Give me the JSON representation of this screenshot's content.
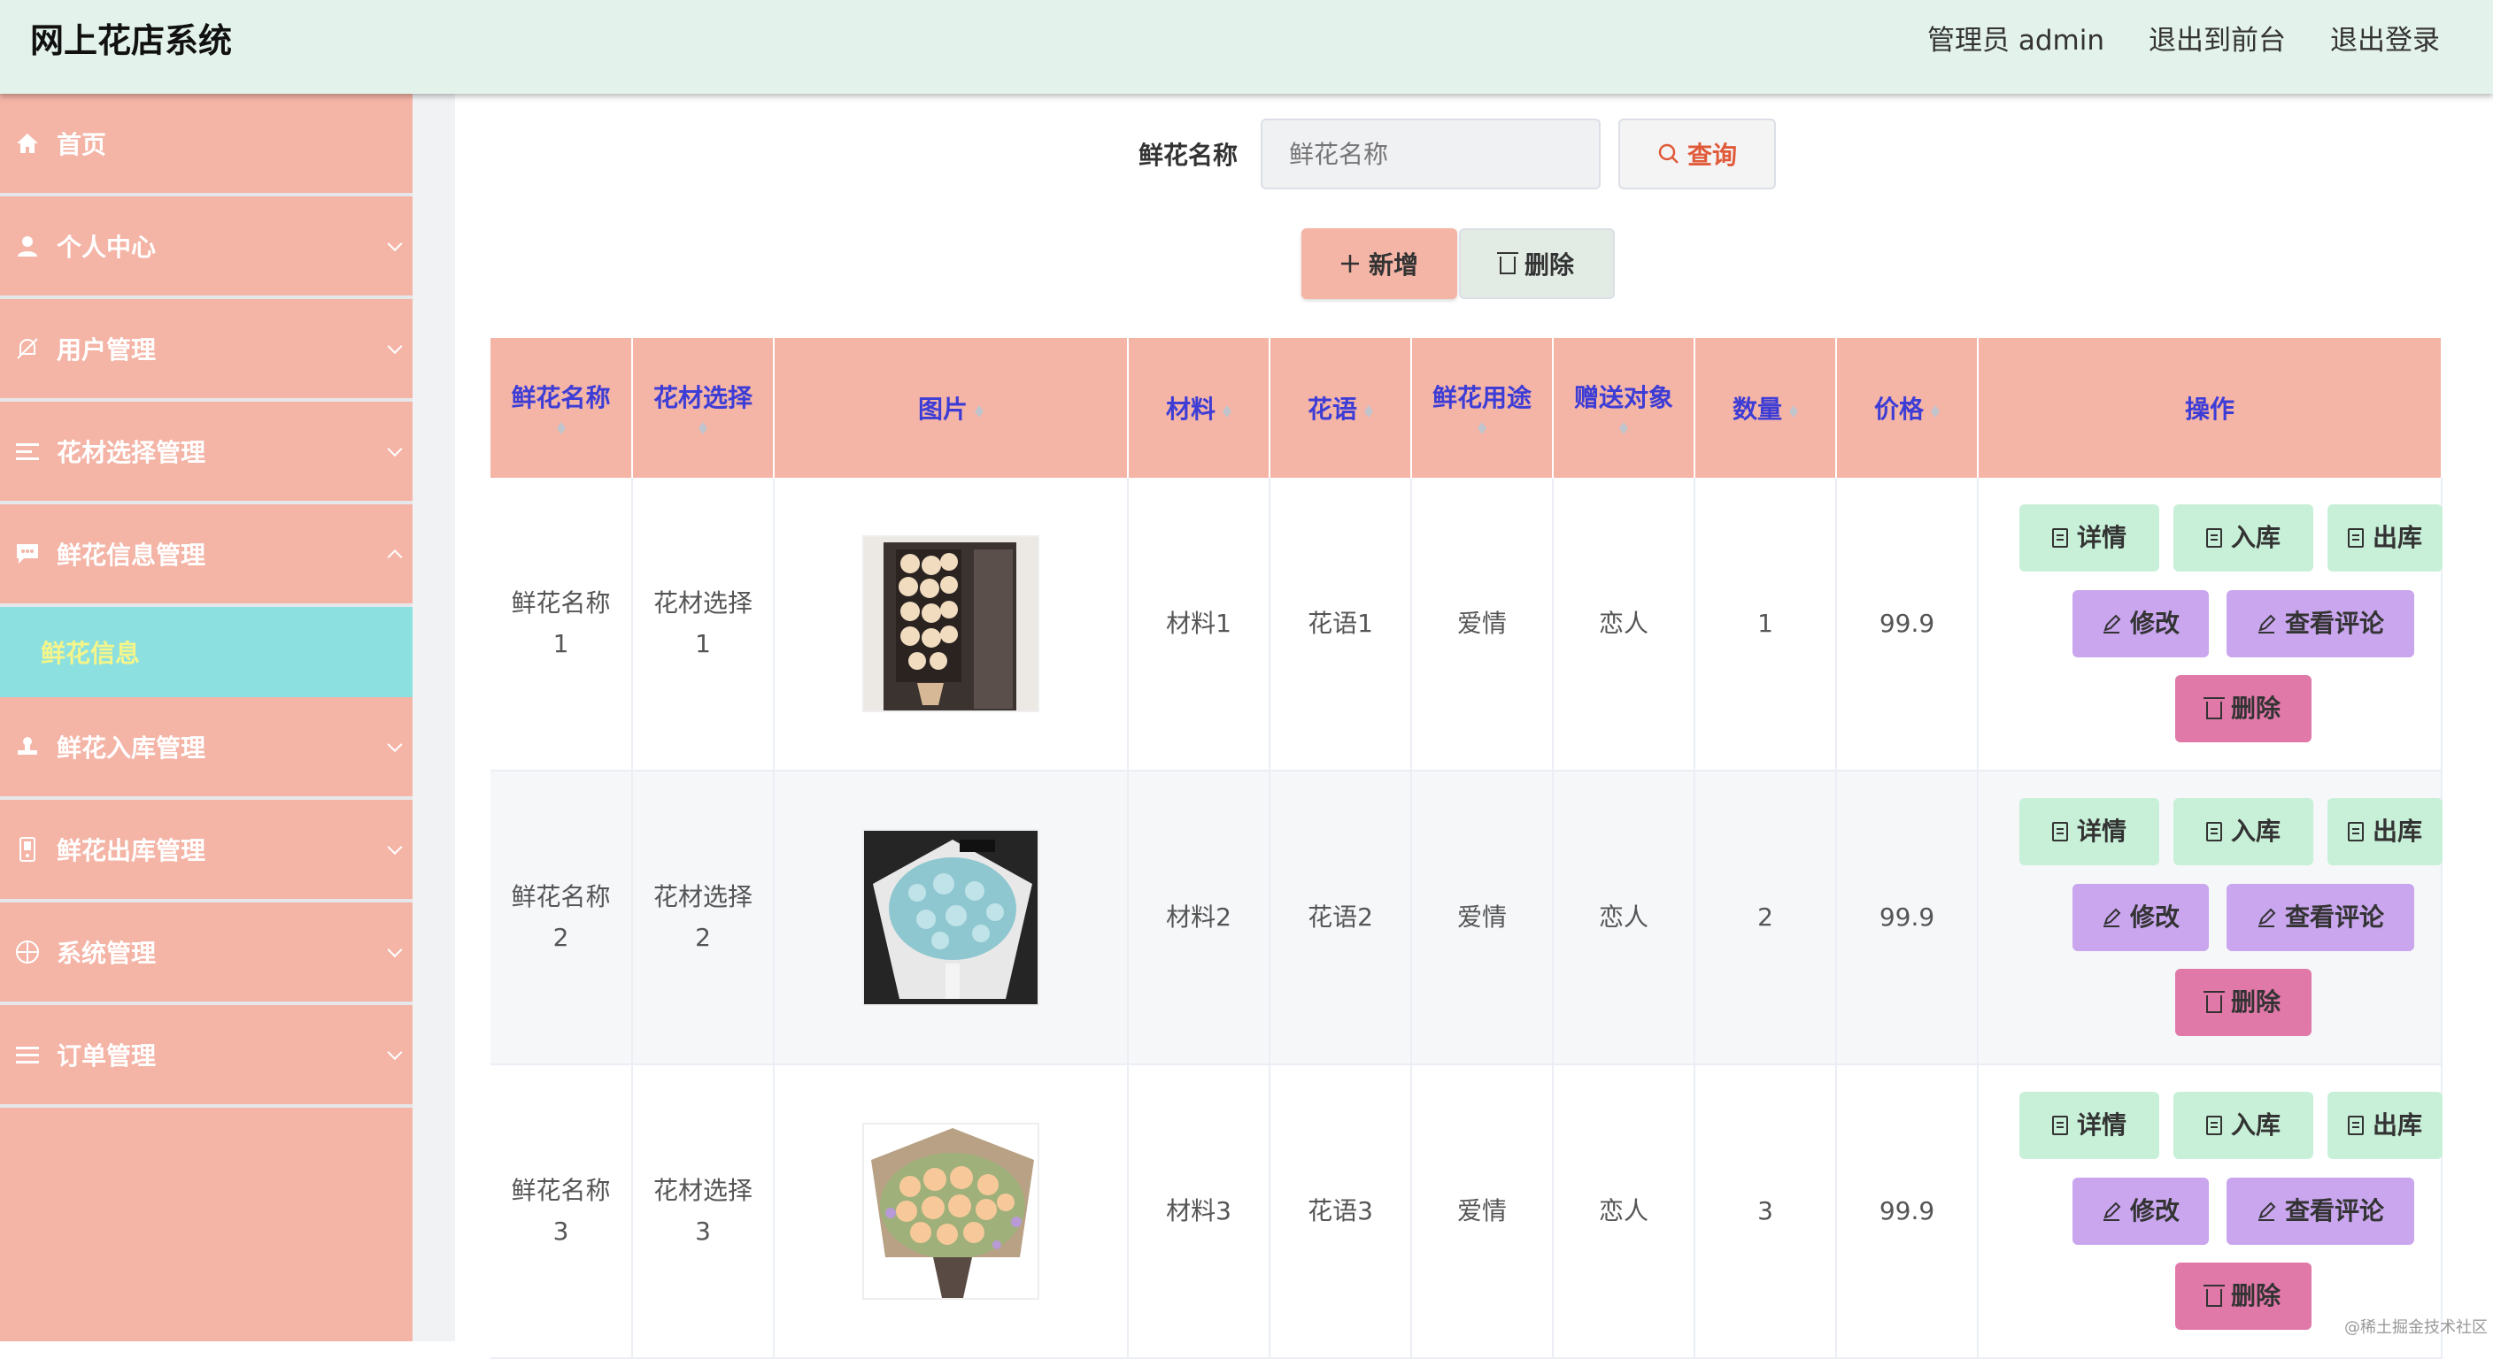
{
  "header": {
    "title": "网上花店系统",
    "admin_label": "管理员 admin",
    "to_front": "退出到前台",
    "logout": "退出登录"
  },
  "sidebar": {
    "items": [
      {
        "label": "首页",
        "icon": "home-icon"
      },
      {
        "label": "个人中心",
        "icon": "user-icon"
      },
      {
        "label": "用户管理",
        "icon": "bell-off-icon"
      },
      {
        "label": "花材选择管理",
        "icon": "list-icon"
      },
      {
        "label": "鲜花信息管理",
        "icon": "chat-icon"
      },
      {
        "label": "鲜花入库管理",
        "icon": "stamp-icon"
      },
      {
        "label": "鲜花出库管理",
        "icon": "phone-icon"
      },
      {
        "label": "系统管理",
        "icon": "globe-icon"
      },
      {
        "label": "订单管理",
        "icon": "menu-icon"
      }
    ],
    "active_sub": "鲜花信息"
  },
  "search": {
    "label": "鲜花名称",
    "placeholder": "鲜花名称",
    "query_label": "查询"
  },
  "toolbar": {
    "add_label": "新增",
    "delete_label": "删除"
  },
  "table": {
    "headers": [
      "鲜花名称",
      "花材选择",
      "图片",
      "材料",
      "花语",
      "鲜花用途",
      "赠送对象",
      "数量",
      "价格",
      "操作"
    ],
    "rows": [
      {
        "name": "鲜花名称",
        "name_no": "1",
        "material_choice": "花材选择",
        "material_no": "1",
        "material": "材料1",
        "language": "花语1",
        "use": "爱情",
        "target": "恋人",
        "qty": "1",
        "price": "99.9"
      },
      {
        "name": "鲜花名称",
        "name_no": "2",
        "material_choice": "花材选择",
        "material_no": "2",
        "material": "材料2",
        "language": "花语2",
        "use": "爱情",
        "target": "恋人",
        "qty": "2",
        "price": "99.9"
      },
      {
        "name": "鲜花名称",
        "name_no": "3",
        "material_choice": "花材选择",
        "material_no": "3",
        "material": "材料3",
        "language": "花语3",
        "use": "爱情",
        "target": "恋人",
        "qty": "3",
        "price": "99.9"
      }
    ],
    "ops": {
      "detail": "详情",
      "in": "入库",
      "out": "出库",
      "edit": "修改",
      "review": "查看评论",
      "delete": "删除"
    }
  },
  "watermark": "@稀土掘金技术社区"
}
